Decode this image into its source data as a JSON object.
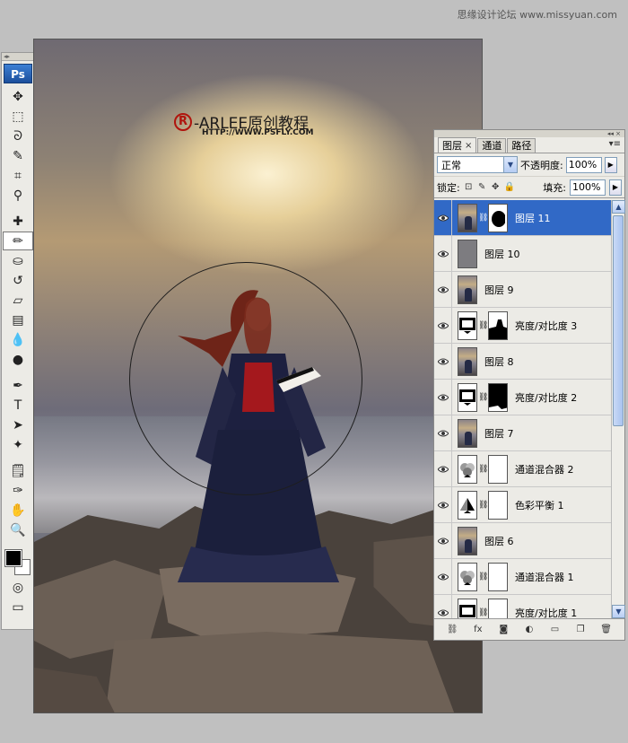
{
  "watermark": "思缘设计论坛 www.missyuan.com",
  "toolbox": {
    "logo": "Ps",
    "tools": [
      {
        "name": "move-tool",
        "glyph": "✥"
      },
      {
        "name": "marquee-tool",
        "glyph": "⬚"
      },
      {
        "name": "lasso-tool",
        "glyph": "ᘐ"
      },
      {
        "name": "quick-select-tool",
        "glyph": "✎"
      },
      {
        "name": "crop-tool",
        "glyph": "⌗"
      },
      {
        "name": "eyedropper-tool",
        "glyph": "⚲"
      },
      {
        "name": "healing-brush-tool",
        "glyph": "✚"
      },
      {
        "name": "brush-tool",
        "glyph": "✏"
      },
      {
        "name": "clone-stamp-tool",
        "glyph": "⛀"
      },
      {
        "name": "history-brush-tool",
        "glyph": "↺"
      },
      {
        "name": "eraser-tool",
        "glyph": "▱"
      },
      {
        "name": "gradient-tool",
        "glyph": "▤"
      },
      {
        "name": "blur-tool",
        "glyph": "💧"
      },
      {
        "name": "dodge-tool",
        "glyph": "●"
      },
      {
        "name": "pen-tool",
        "glyph": "✒"
      },
      {
        "name": "type-tool",
        "glyph": "T"
      },
      {
        "name": "path-select-tool",
        "glyph": "➤"
      },
      {
        "name": "shape-tool",
        "glyph": "✦"
      },
      {
        "name": "notes-tool",
        "glyph": "🗒"
      },
      {
        "name": "eyedropper2-tool",
        "glyph": "✑"
      },
      {
        "name": "hand-tool",
        "glyph": "✋"
      },
      {
        "name": "zoom-tool",
        "glyph": "🔍"
      }
    ],
    "active_tool": "brush-tool"
  },
  "canvas": {
    "logo_mark": "R",
    "logo_text": "-ARLEE原创教程",
    "logo_url": "HTTP://WWW.PSFLY.COM"
  },
  "layers_panel": {
    "tabs": [
      {
        "label": "图层",
        "close": "×",
        "active": true
      },
      {
        "label": "通道",
        "close": "",
        "active": false
      },
      {
        "label": "路径",
        "close": "",
        "active": false
      }
    ],
    "blend_mode": "正常",
    "opacity_label": "不透明度:",
    "opacity_value": "100%",
    "lock_label": "锁定:",
    "fill_label": "填充:",
    "fill_value": "100%",
    "layers": [
      {
        "name": "图层 11",
        "thumb": "photo",
        "mask": "black-spot",
        "selected": true
      },
      {
        "name": "图层 10",
        "thumb": "gray",
        "mask": null,
        "selected": false
      },
      {
        "name": "图层 9",
        "thumb": "photo",
        "mask": null,
        "selected": false
      },
      {
        "name": "亮度/对比度 3",
        "thumb": "brightness",
        "mask": "black-bottom",
        "selected": false
      },
      {
        "name": "图层 8",
        "thumb": "photo",
        "mask": null,
        "selected": false
      },
      {
        "name": "亮度/对比度 2",
        "thumb": "brightness",
        "mask": "black-top",
        "selected": false
      },
      {
        "name": "图层 7",
        "thumb": "photo",
        "mask": null,
        "selected": false
      },
      {
        "name": "通道混合器 2",
        "thumb": "mixer",
        "mask": "white",
        "selected": false
      },
      {
        "name": "色彩平衡 1",
        "thumb": "balance",
        "mask": "white",
        "selected": false
      },
      {
        "name": "图层 6",
        "thumb": "photo",
        "mask": null,
        "selected": false
      },
      {
        "name": "通道混合器 1",
        "thumb": "mixer",
        "mask": "white",
        "selected": false
      },
      {
        "name": "亮度/对比度 1",
        "thumb": "brightness",
        "mask": "white",
        "selected": false
      }
    ],
    "footer_buttons": [
      {
        "name": "link-layers-button",
        "glyph": "⛓"
      },
      {
        "name": "layer-style-button",
        "glyph": "fx"
      },
      {
        "name": "add-mask-button",
        "glyph": "◙"
      },
      {
        "name": "adjustment-layer-button",
        "glyph": "◐"
      },
      {
        "name": "new-group-button",
        "glyph": "▭"
      },
      {
        "name": "new-layer-button",
        "glyph": "❐"
      },
      {
        "name": "delete-layer-button",
        "glyph": "🗑"
      }
    ]
  }
}
